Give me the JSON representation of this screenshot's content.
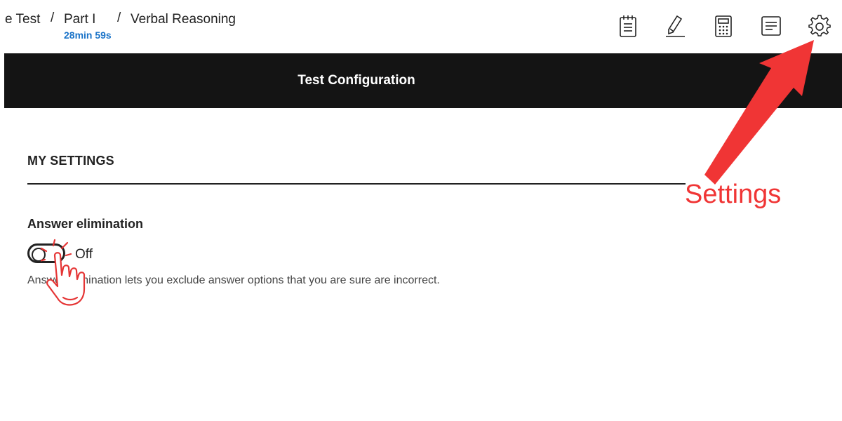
{
  "breadcrumb": {
    "item1": "e Test",
    "sep": "/",
    "item2": "Part I",
    "item3": "Verbal Reasoning",
    "timer": "28min 59s"
  },
  "toolbar": {
    "icons": [
      "notepad-icon",
      "highlighter-icon",
      "calculator-icon",
      "notes-icon",
      "gear-icon"
    ]
  },
  "header": {
    "title": "Test Configuration"
  },
  "settings": {
    "section_title": "MY SETTINGS",
    "answer_elimination": {
      "title": "Answer elimination",
      "toggle_state": "Off",
      "description": "Answer elimination lets you exclude answer options that you are sure are incorrect."
    }
  },
  "annotation": {
    "callout_label": "Settings",
    "color": "#f03535"
  }
}
